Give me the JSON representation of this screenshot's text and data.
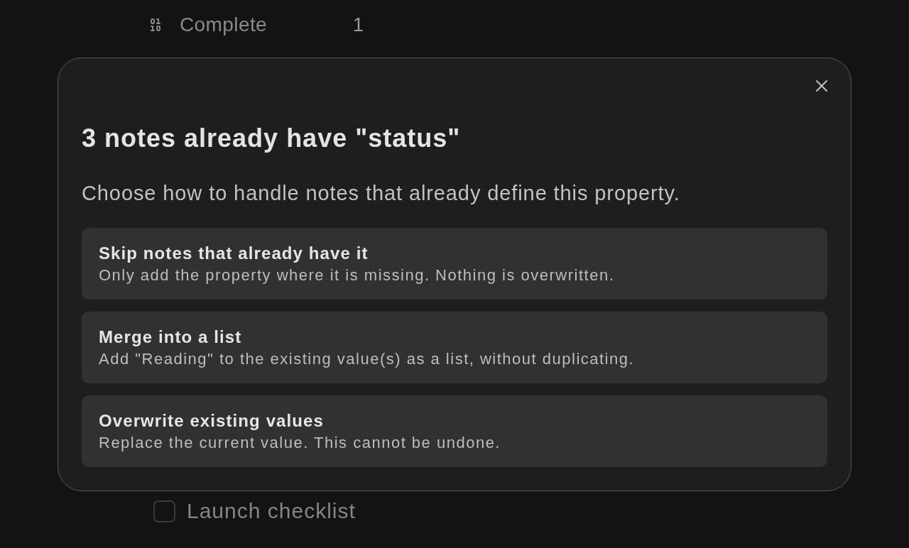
{
  "background": {
    "property": {
      "name": "Complete",
      "value": "1"
    },
    "task": {
      "label": "Launch checklist",
      "checked": false
    }
  },
  "dialog": {
    "title": "3 notes already have \"status\"",
    "description": "Choose how to handle notes that already define this property.",
    "options": [
      {
        "title": "Skip notes that already have it",
        "description": "Only add the property where it is missing. Nothing is overwritten."
      },
      {
        "title": "Merge into a list",
        "description": "Add \"Reading\" to the existing value(s) as a list, without duplicating."
      },
      {
        "title": "Overwrite existing values",
        "description": "Replace the current value. This cannot be undone."
      }
    ]
  }
}
